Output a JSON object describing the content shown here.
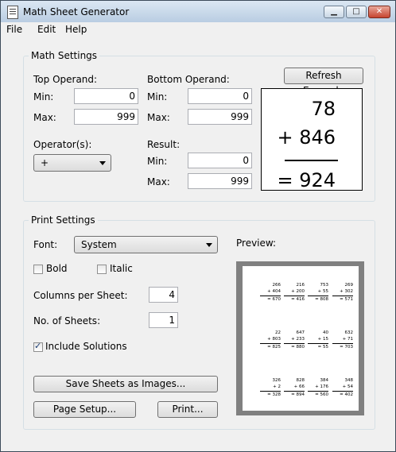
{
  "window": {
    "title": "Math Sheet Generator"
  },
  "menu": [
    "File",
    "Edit",
    "Help"
  ],
  "math_settings": {
    "title": "Math Settings",
    "top_operand_label": "Top Operand:",
    "bottom_operand_label": "Bottom Operand:",
    "min_label": "Min:",
    "max_label": "Max:",
    "top_min": "0",
    "top_max": "999",
    "bottom_min": "0",
    "bottom_max": "999",
    "operators_label": "Operator(s):",
    "operator_value": "+",
    "result_label": "Result:",
    "result_min": "0",
    "result_max": "999",
    "refresh_button": "Refresh Example",
    "example": {
      "top": "78",
      "bottom": "+ 846",
      "result": "= 924"
    }
  },
  "print_settings": {
    "title": "Print Settings",
    "font_label": "Font:",
    "font_value": "System",
    "bold_label": "Bold",
    "bold_checked": false,
    "italic_label": "Italic",
    "italic_checked": false,
    "columns_label": "Columns per Sheet:",
    "columns_value": "4",
    "sheets_label": "No. of Sheets:",
    "sheets_value": "1",
    "solutions_label": "Include Solutions",
    "solutions_checked": true,
    "preview_label": "Preview:",
    "save_images_button": "Save Sheets as Images...",
    "page_setup_button": "Page Setup...",
    "print_button": "Print..."
  },
  "preview_problems": [
    {
      "a": "266",
      "b": "+ 404",
      "r": "= 670"
    },
    {
      "a": "216",
      "b": "+ 200",
      "r": "= 416"
    },
    {
      "a": "753",
      "b": "+ 55",
      "r": "= 808"
    },
    {
      "a": "269",
      "b": "+ 302",
      "r": "= 571"
    },
    {
      "a": "22",
      "b": "+ 803",
      "r": "= 825"
    },
    {
      "a": "647",
      "b": "+ 233",
      "r": "= 880"
    },
    {
      "a": "40",
      "b": "+ 15",
      "r": "= 55"
    },
    {
      "a": "632",
      "b": "+ 71",
      "r": "= 703"
    },
    {
      "a": "326",
      "b": "+ 2",
      "r": "= 328"
    },
    {
      "a": "828",
      "b": "+ 66",
      "r": "= 894"
    },
    {
      "a": "384",
      "b": "+ 176",
      "r": "= 560"
    },
    {
      "a": "348",
      "b": "+ 54",
      "r": "= 402"
    }
  ],
  "colors": {
    "titlebar": "#c6d8ea",
    "client": "#f0f0f0",
    "close_button": "#c6442f"
  }
}
